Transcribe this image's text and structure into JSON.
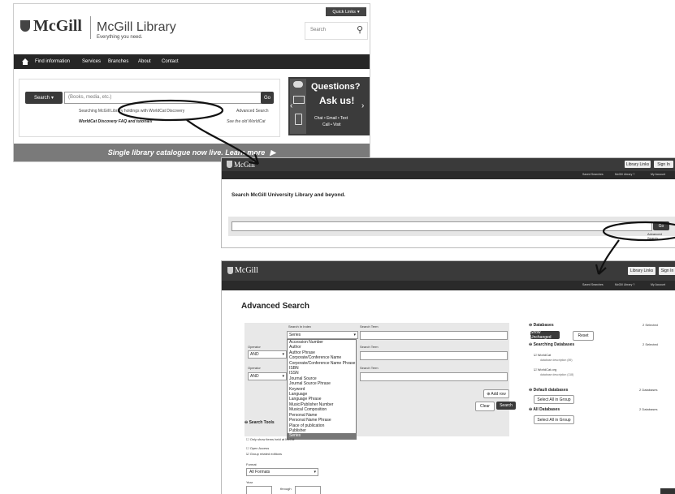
{
  "panel1": {
    "logo_text": "McGill",
    "library_title": "McGill Library",
    "library_subtitle": "Everything you need.",
    "quick_links": "Quick Links",
    "search_placeholder": "Search",
    "nav": [
      "Find information",
      "Services",
      "Branches",
      "About",
      "Contact"
    ],
    "search_type": "Search",
    "search_input_placeholder": "(Books, media, etc.)",
    "go_button": "Go",
    "searching_note": "Searching McGill Library holdings with WorldCat Discovery",
    "advanced_search": "Advanced Search",
    "faq_link": "WorldCat Discovery FAQ and tutorials",
    "old_worldcat": "See the old WorldCat",
    "questions_title": "Questions?",
    "ask_us": "Ask us!",
    "contact_methods": "Chat • Email • Text",
    "contact_methods2": "Call • Visit",
    "banner": "Single library catalogue now live. Learn more"
  },
  "panel2": {
    "logo_text": "McGill",
    "library_links": "Library Links",
    "sign_in": "Sign In",
    "util_links": [
      "Saved Searches",
      "McGill Library ?",
      "My Account"
    ],
    "heading": "Search McGill University Library and beyond.",
    "go_button": "Go",
    "advanced_search": "Advanced Search"
  },
  "panel3": {
    "logo_text": "McGill",
    "library_links": "Library Links",
    "sign_in": "Sign In",
    "util_links": [
      "Saved Searches",
      "McGill Library ?",
      "My Account"
    ],
    "title": "Advanced Search",
    "search_in_label": "Search In Index",
    "search_in_value": "Series",
    "search_term_label": "Search Term",
    "operator_label": "Operator",
    "operator_value": "AND",
    "index_options": [
      "Accession Number",
      "Author",
      "Author Phrase",
      "Corporate/Conference Name",
      "Corporate/Conference Name Phrase",
      "ISBN",
      "ISSN",
      "Journal Source",
      "Journal Source Phrase",
      "Keyword",
      "Language",
      "Language Phrase",
      "Music/Publisher Number",
      "Musical Composition",
      "Personal Name",
      "Personal Name Phrase",
      "Place of publication",
      "Publisher",
      "Series",
      "Series Phrase"
    ],
    "selected_index": "Series",
    "add_row": "Add row",
    "clear_button": "Clear",
    "search_button": "Search",
    "search_tools": "Search Tools",
    "only_show_held": "Only show items held at McGill",
    "open_access": "Open Access",
    "group_related": "Group related editions",
    "format_label": "Format",
    "format_value": "All Formats",
    "year_label": "Year",
    "through_label": "through",
    "databases_title": "Databases",
    "databases_count": "2 Selected",
    "show_unchanged": "Show Unchanged",
    "reset": "Reset",
    "searching_databases": "Searching Databases",
    "searching_count": "2 Selected",
    "db1_name": "WorldCat",
    "db1_desc": "database description (89)",
    "db2_name": "WorldCat.org",
    "db2_desc": "database description (118)",
    "default_databases": "Default databases",
    "default_count": "2 Databases",
    "select_all_group1": "Select All in Group",
    "all_databases": "All Databases",
    "all_count": "2 Databases",
    "select_all_group2": "Select All in Group"
  },
  "colors": {
    "dark_bar": "#2b2b2b",
    "banner_gray": "#7a7a7a",
    "mcgill_red": "#8a1a1a"
  }
}
